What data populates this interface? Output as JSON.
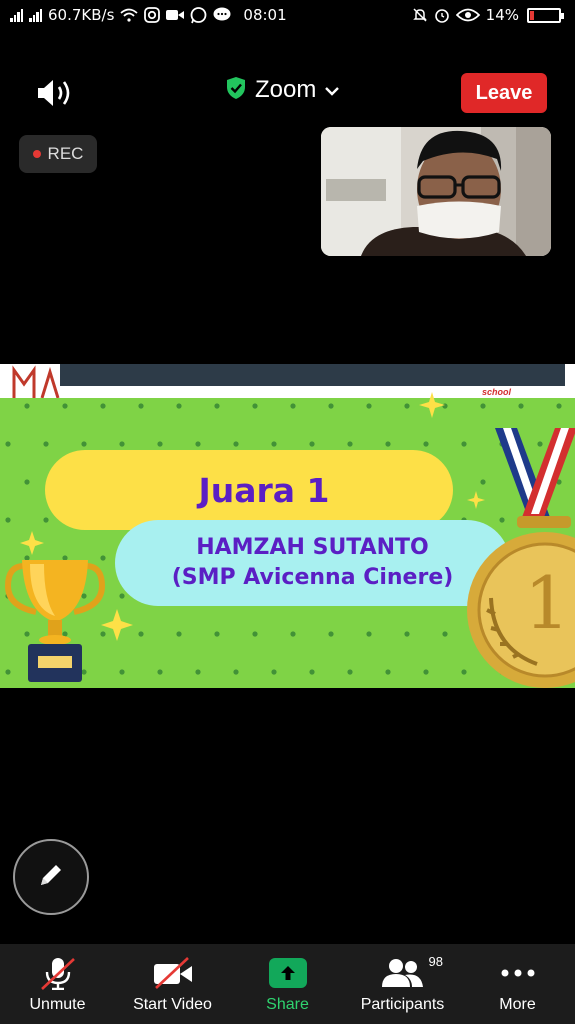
{
  "status_bar": {
    "net_speed": "60.7KB/s",
    "time": "08:01",
    "battery": "14%",
    "battery_level": 0.14,
    "icons": [
      "signal-icon",
      "wifi-icon",
      "instagram-icon",
      "video-icon",
      "whatsapp-icon",
      "chat-icon",
      "bell-off-icon",
      "alarm-icon",
      "eye-icon",
      "battery-icon"
    ]
  },
  "meeting": {
    "app_title": "Zoom",
    "leave_label": "Leave",
    "rec_label": "REC"
  },
  "slide": {
    "award_title": "Juara 1",
    "winner_name": "HAMZAH SUTANTO",
    "winner_school": "(SMP Avicenna Cinere)",
    "brand_text": "school",
    "medal_number": "1"
  },
  "toolbar": {
    "items": [
      {
        "label": "Unmute",
        "icon": "mic-muted-icon"
      },
      {
        "label": "Start Video",
        "icon": "video-off-icon"
      },
      {
        "label": "Share",
        "icon": "share-arrow-icon"
      },
      {
        "label": "Participants",
        "icon": "participants-icon",
        "count": "98"
      },
      {
        "label": "More",
        "icon": "more-dots-icon"
      }
    ]
  },
  "colors": {
    "leave": "#e02828",
    "share": "#12a85a",
    "slide_bg": "#7fd346",
    "pill_yellow": "#fde047",
    "pill_cyan": "#a8f0f0",
    "text_purple": "#5b1fc4"
  }
}
